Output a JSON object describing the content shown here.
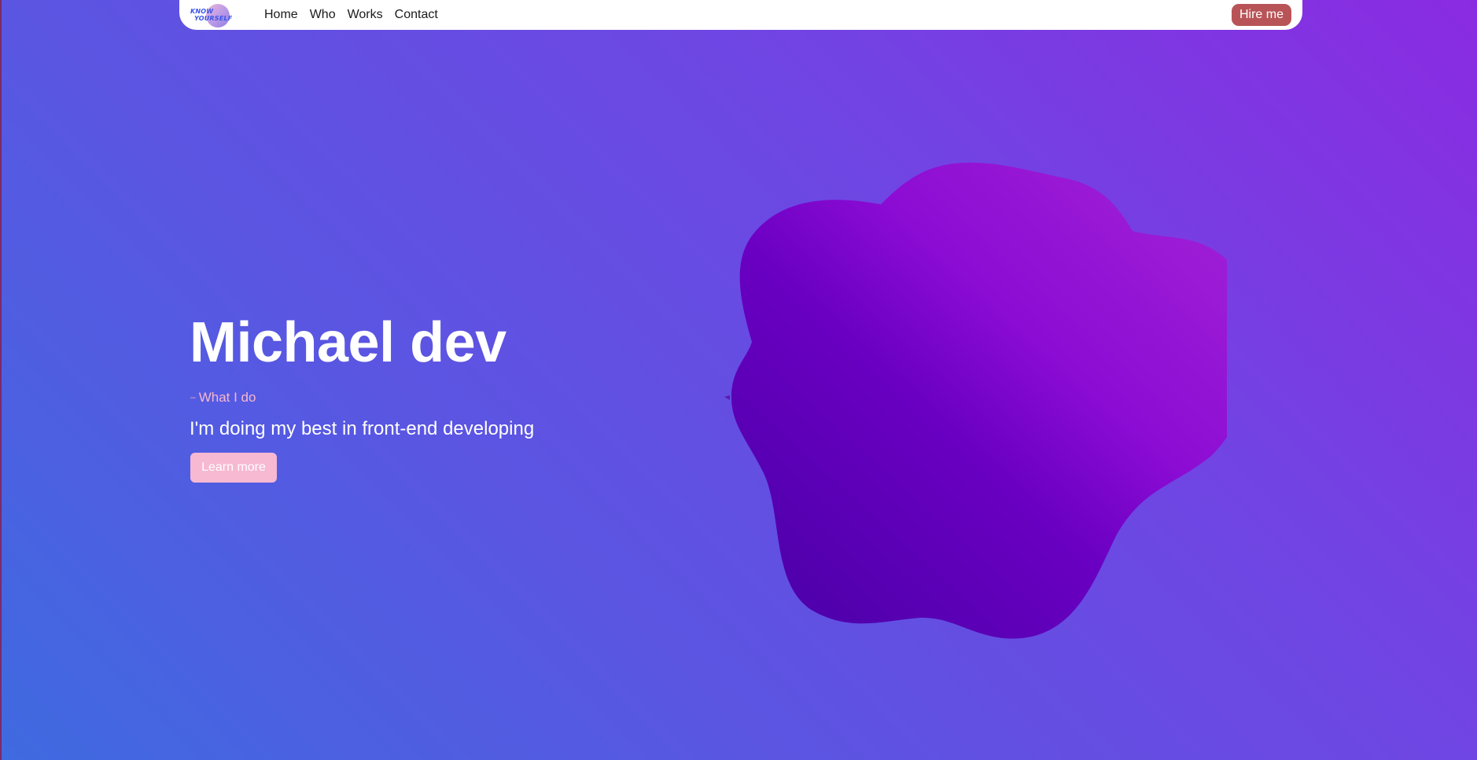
{
  "navbar": {
    "logo": {
      "line1": "KNOW",
      "line2": "YOURSELF"
    },
    "links": [
      "Home",
      "Who",
      "Works",
      "Contact"
    ],
    "hire_label": "Hire me"
  },
  "hero": {
    "title": "Michael dev",
    "subtitle_dash": "–",
    "subtitle": "What I do",
    "description": "I'm doing my best in front-end developing",
    "button_label": "Learn more"
  },
  "colors": {
    "background_start": "#3f6ae0",
    "background_end": "#8a2be2",
    "hire_button": "#b85457",
    "learn_button": "#f7b8d2",
    "subtitle": "#f7b7cf",
    "blob_dark": "#4b00a8",
    "blob_light": "#a222d6"
  }
}
